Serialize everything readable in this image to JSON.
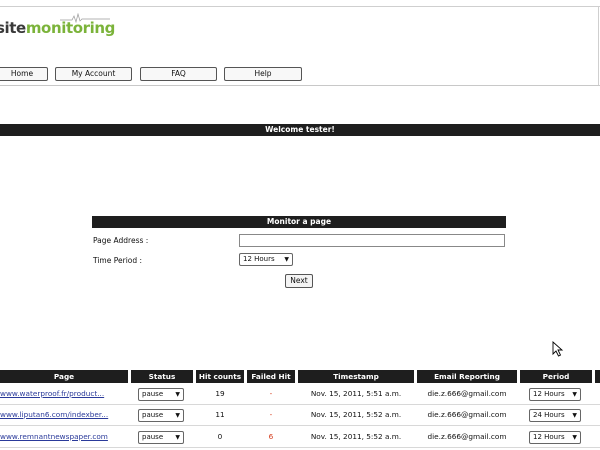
{
  "logo": {
    "site": "site",
    "monitoring": "monitoring"
  },
  "nav": {
    "home": "Home",
    "account": "My Account",
    "faq": "FAQ",
    "help": "Help"
  },
  "welcome": "Welcome tester!",
  "monitor_form": {
    "title": "Monitor a page",
    "page_address_label": "Page Address :",
    "page_address_value": "",
    "time_period_label": "Time Period :",
    "time_period_value": "12 Hours",
    "next_label": "Next"
  },
  "table": {
    "headers": [
      "Page",
      "Status",
      "Hit counts",
      "Failed Hit",
      "Timestamp",
      "Email Reporting",
      "Period"
    ],
    "rows": [
      {
        "page": "www.waterproof.fr/product...",
        "status": "pause",
        "hits": "19",
        "failed": "-",
        "timestamp": "Nov. 15, 2011, 5:51 a.m.",
        "email": "die.z.666@gmail.com",
        "period": "12 Hours"
      },
      {
        "page": "www.liputan6.com/indexber...",
        "status": "pause",
        "hits": "11",
        "failed": "-",
        "timestamp": "Nov. 15, 2011, 5:52 a.m.",
        "email": "die.z.666@gmail.com",
        "period": "24 Hours"
      },
      {
        "page": "www.remnantnewspaper.com",
        "status": "pause",
        "hits": "0",
        "failed": "6",
        "timestamp": "Nov. 15, 2011, 5:52 a.m.",
        "email": "die.z.666@gmail.com",
        "period": "12 Hours"
      }
    ]
  },
  "colors": {
    "header_bg": "#1e1e1e",
    "logo_green": "#7bb33a",
    "failed_red": "#d43a1a",
    "link": "#2a3a9a"
  }
}
